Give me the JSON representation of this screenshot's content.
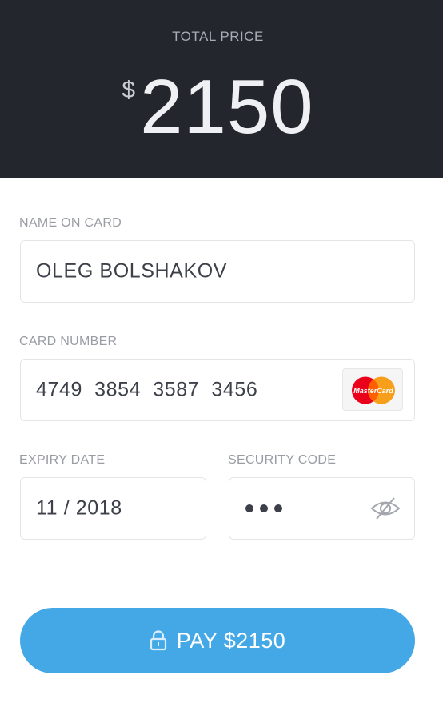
{
  "header": {
    "label": "TOTAL PRICE",
    "currency": "$",
    "amount": "2150"
  },
  "form": {
    "name": {
      "label": "NAME ON CARD",
      "value": "OLEG BOLSHAKOV"
    },
    "card_number": {
      "label": "CARD NUMBER",
      "value": "4749  3854  3587  3456",
      "brand": "MasterCard",
      "brand_icon": "mastercard-logo"
    },
    "expiry": {
      "label": "EXPIRY DATE",
      "value": "11 / 2018"
    },
    "security": {
      "label": "SECURITY CODE",
      "masked_dots": 3,
      "toggle_icon": "eye-slash-icon"
    }
  },
  "pay_button": {
    "label": "PAY $2150",
    "icon": "lock-icon"
  },
  "colors": {
    "header_bg": "#24262d",
    "accent": "#44a8e6",
    "text_dark": "#3d4049",
    "label_gray": "#9a9ca3",
    "mastercard_red": "#eb001b",
    "mastercard_yellow": "#f79e1b"
  }
}
